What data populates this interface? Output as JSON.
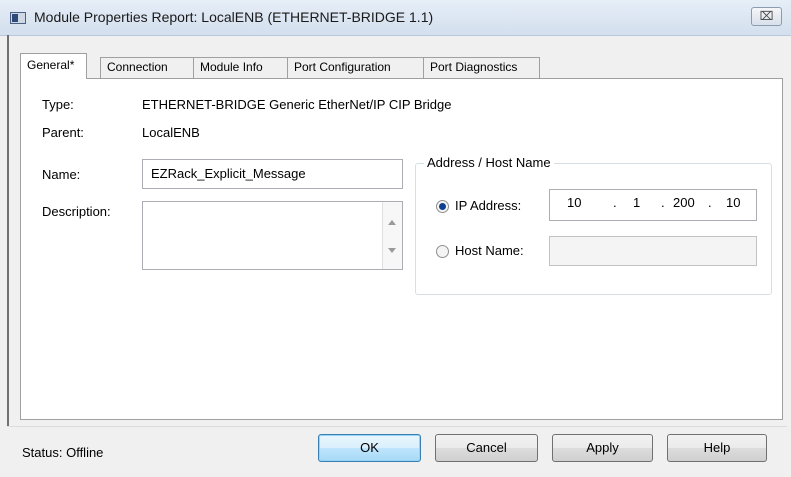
{
  "window": {
    "title": "Module Properties Report: LocalENB (ETHERNET-BRIDGE 1.1)",
    "close_label": "⌧"
  },
  "tabs": [
    {
      "label": "General*",
      "active": true
    },
    {
      "label": "Connection",
      "active": false
    },
    {
      "label": "Module Info",
      "active": false
    },
    {
      "label": "Port Configuration",
      "active": false
    },
    {
      "label": "Port Diagnostics",
      "active": false
    }
  ],
  "general": {
    "type_label": "Type:",
    "type_value": "ETHERNET-BRIDGE Generic EtherNet/IP CIP Bridge",
    "parent_label": "Parent:",
    "parent_value": "LocalENB",
    "name_label": "Name:",
    "name_value": "EZRack_Explicit_Message",
    "description_label": "Description:",
    "description_value": ""
  },
  "address": {
    "group_title": "Address / Host Name",
    "ip_label": "IP Address:",
    "ip_octets": [
      "10",
      "1",
      "200",
      "10"
    ],
    "ip_separator": ".",
    "ip_selected": true,
    "host_label": "Host Name:",
    "host_value": "",
    "host_selected": false
  },
  "footer": {
    "status_text": "Status:  Offline",
    "ok_label": "OK",
    "cancel_label": "Cancel",
    "apply_label": "Apply",
    "help_label": "Help"
  },
  "colors": {
    "title_bar": "#d3dfee",
    "default_button": "#bee6fd",
    "radio_dot": "#0f3f8f"
  }
}
